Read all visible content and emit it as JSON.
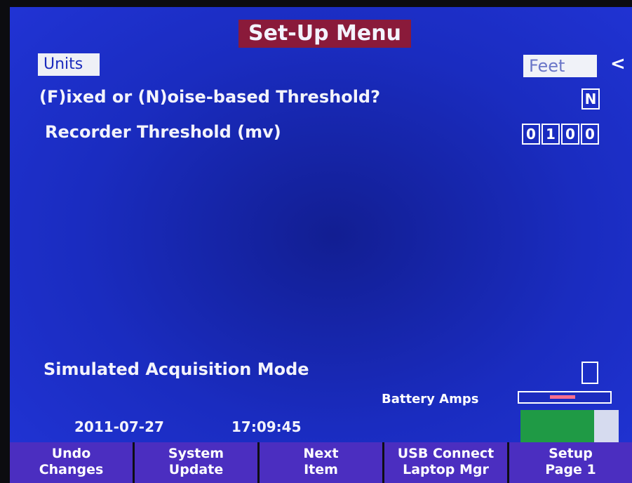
{
  "title": "Set-Up Menu",
  "units": {
    "label": "Units",
    "value": "Feet",
    "selected_marker": "<"
  },
  "threshold_type": {
    "label": "(F)ixed or (N)oise-based Threshold?",
    "value": "N"
  },
  "recorder_threshold": {
    "label": "Recorder Threshold (mv)",
    "digits": [
      "0",
      "1",
      "0",
      "0"
    ]
  },
  "simulated_mode": {
    "label": "Simulated Acquisition Mode",
    "checked": false
  },
  "battery": {
    "label": "Battery Amps",
    "gauge_level": 0.75
  },
  "status": {
    "date": "2011-07-27",
    "time": "17:09:45"
  },
  "softkeys": [
    {
      "line1": "Undo",
      "line2": "Changes"
    },
    {
      "line1": "System",
      "line2": "Update"
    },
    {
      "line1": "Next",
      "line2": "Item"
    },
    {
      "line1": "USB Connect",
      "line2": "Laptop Mgr"
    },
    {
      "line1": "Setup",
      "line2": "Page 1"
    }
  ],
  "colors": {
    "background": "#1a2cc0",
    "title_bg": "#8a1a3a",
    "softkey_bg": "#4b2ec0",
    "gauge_fill": "#1f9a45"
  }
}
